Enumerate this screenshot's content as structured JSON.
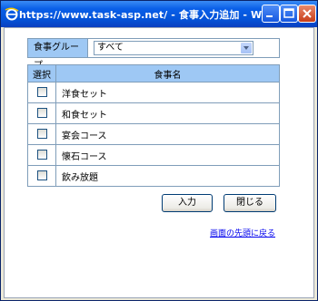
{
  "window": {
    "title": "https://www.task-asp.net/ - 食事入力追加 - Window...",
    "colors": {
      "title_bar": "#0a5fe8",
      "header_bg": "#9ec8f4",
      "border": "#7f9db9",
      "link": "#0000ee"
    }
  },
  "filter": {
    "label": "食事グループ",
    "selected": "すべて"
  },
  "table": {
    "headers": {
      "select": "選択",
      "name": "食事名"
    },
    "rows": [
      {
        "name": "洋食セット",
        "checked": false
      },
      {
        "name": "和食セット",
        "checked": false
      },
      {
        "name": "宴会コース",
        "checked": false
      },
      {
        "name": "懐石コース",
        "checked": false
      },
      {
        "name": "飲み放題",
        "checked": false
      }
    ]
  },
  "buttons": {
    "submit": "入力",
    "close": "閉じる"
  },
  "link": {
    "back_to_top": "画面の先頭に戻る"
  }
}
